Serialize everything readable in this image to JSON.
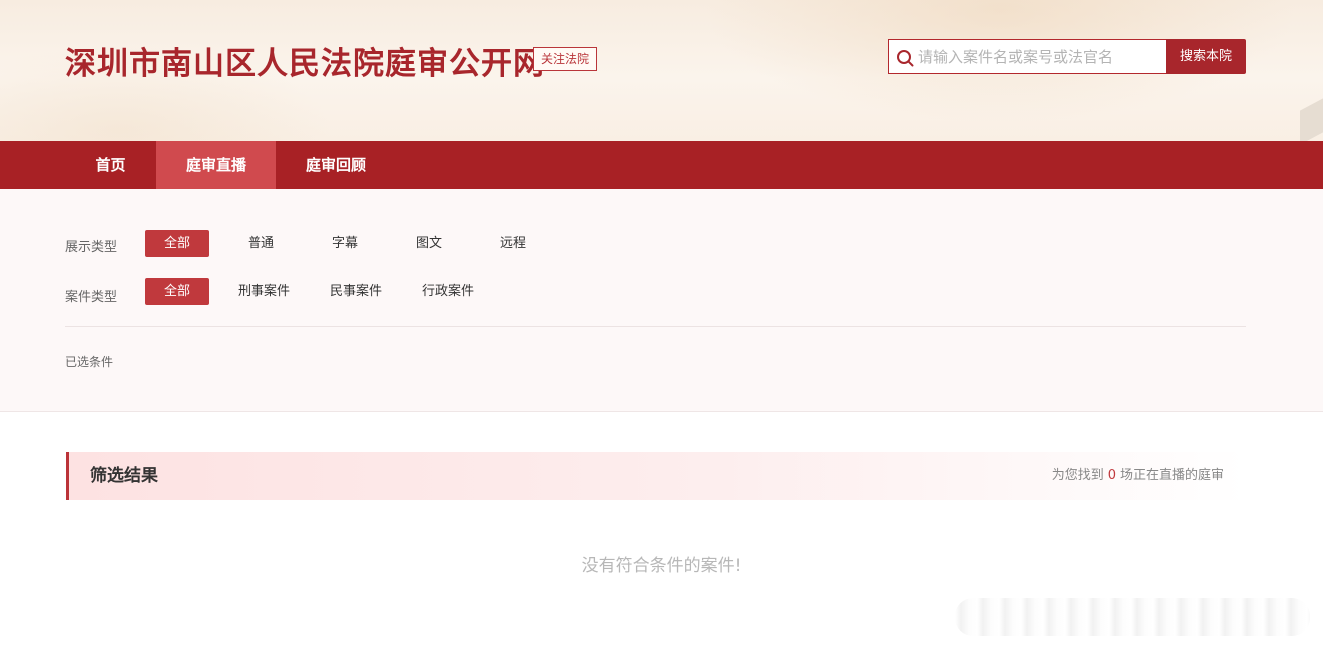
{
  "header": {
    "title": "深圳市南山区人民法院庭审公开网",
    "follow_label": "关注法院",
    "search": {
      "placeholder": "请输入案件名或案号或法官名",
      "value": "",
      "button_label": "搜索本院",
      "icon": "search-icon"
    }
  },
  "nav": {
    "items": [
      {
        "label": "首页",
        "active": false
      },
      {
        "label": "庭审直播",
        "active": true
      },
      {
        "label": "庭审回顾",
        "active": false
      }
    ]
  },
  "filters": {
    "display_type": {
      "label": "展示类型",
      "options": [
        "全部",
        "普通",
        "字幕",
        "图文",
        "远程"
      ],
      "selected": "全部"
    },
    "case_type": {
      "label": "案件类型",
      "options": [
        "全部",
        "刑事案件",
        "民事案件",
        "行政案件"
      ],
      "selected": "全部"
    },
    "selected_conditions_label": "已选条件"
  },
  "results": {
    "title": "筛选结果",
    "count_prefix": "为您找到",
    "count": "0",
    "count_suffix": "场正在直播的庭审",
    "empty_message": "没有符合条件的案件!"
  },
  "colors": {
    "brand_red": "#a8262c",
    "nav_red": "#a82125",
    "nav_active": "#d04a4e",
    "chip_active": "#c0393d"
  }
}
